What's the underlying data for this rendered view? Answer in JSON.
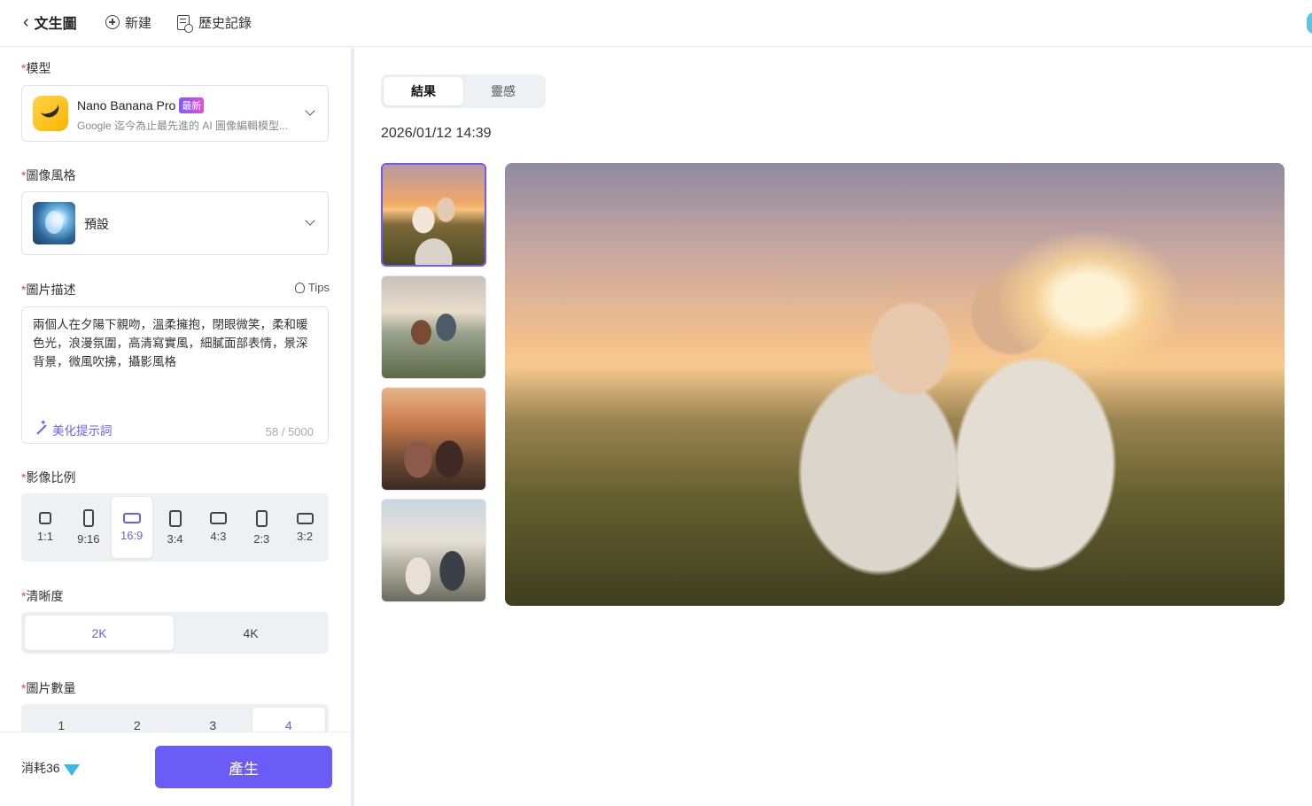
{
  "header": {
    "back_icon": "chevron-left-icon",
    "title": "文生圖",
    "new_label": "新建",
    "new_icon": "plus-circle-icon",
    "history_label": "歷史記錄",
    "history_icon": "history-doc-icon"
  },
  "sidebar": {
    "model": {
      "label": "模型",
      "name": "Nano Banana Pro",
      "badge": "最新",
      "description": "Google 迄今為止最先進的 AI 圖像編輯模型...",
      "icon": "banana-icon"
    },
    "style": {
      "label": "圖像風格",
      "value": "預設"
    },
    "description": {
      "label": "圖片描述",
      "tips_label": "Tips",
      "text": "兩個人在夕陽下親吻，溫柔擁抱，閉眼微笑，柔和暖色光，浪漫氛圍，高清寫實風，細膩面部表情，景深背景，微風吹拂，攝影風格",
      "beautify_label": "美化提示詞",
      "counter": "58 / 5000"
    },
    "aspect_ratio": {
      "label": "影像比例",
      "options": [
        "1:1",
        "9:16",
        "16:9",
        "3:4",
        "4:3",
        "2:3",
        "3:2"
      ],
      "selected": "16:9"
    },
    "resolution": {
      "label": "清晰度",
      "options": [
        "2K",
        "4K"
      ],
      "selected": "2K"
    },
    "quantity": {
      "label": "圖片數量",
      "options": [
        "1",
        "2",
        "3",
        "4"
      ],
      "selected": "4"
    },
    "footer": {
      "cost_label": "消耗36",
      "cost_icon": "diamond-icon",
      "generate_label": "產生"
    }
  },
  "main": {
    "tabs": [
      "結果",
      "靈感"
    ],
    "active_tab": "結果",
    "timestamp": "2026/01/12 14:39",
    "thumbnails_count": 4,
    "selected_thumbnail": 1
  },
  "colors": {
    "accent": "#6b5cf6",
    "required": "#e5484d",
    "badge_gradient_start": "#7a5cff",
    "badge_gradient_end": "#e64fd0"
  }
}
